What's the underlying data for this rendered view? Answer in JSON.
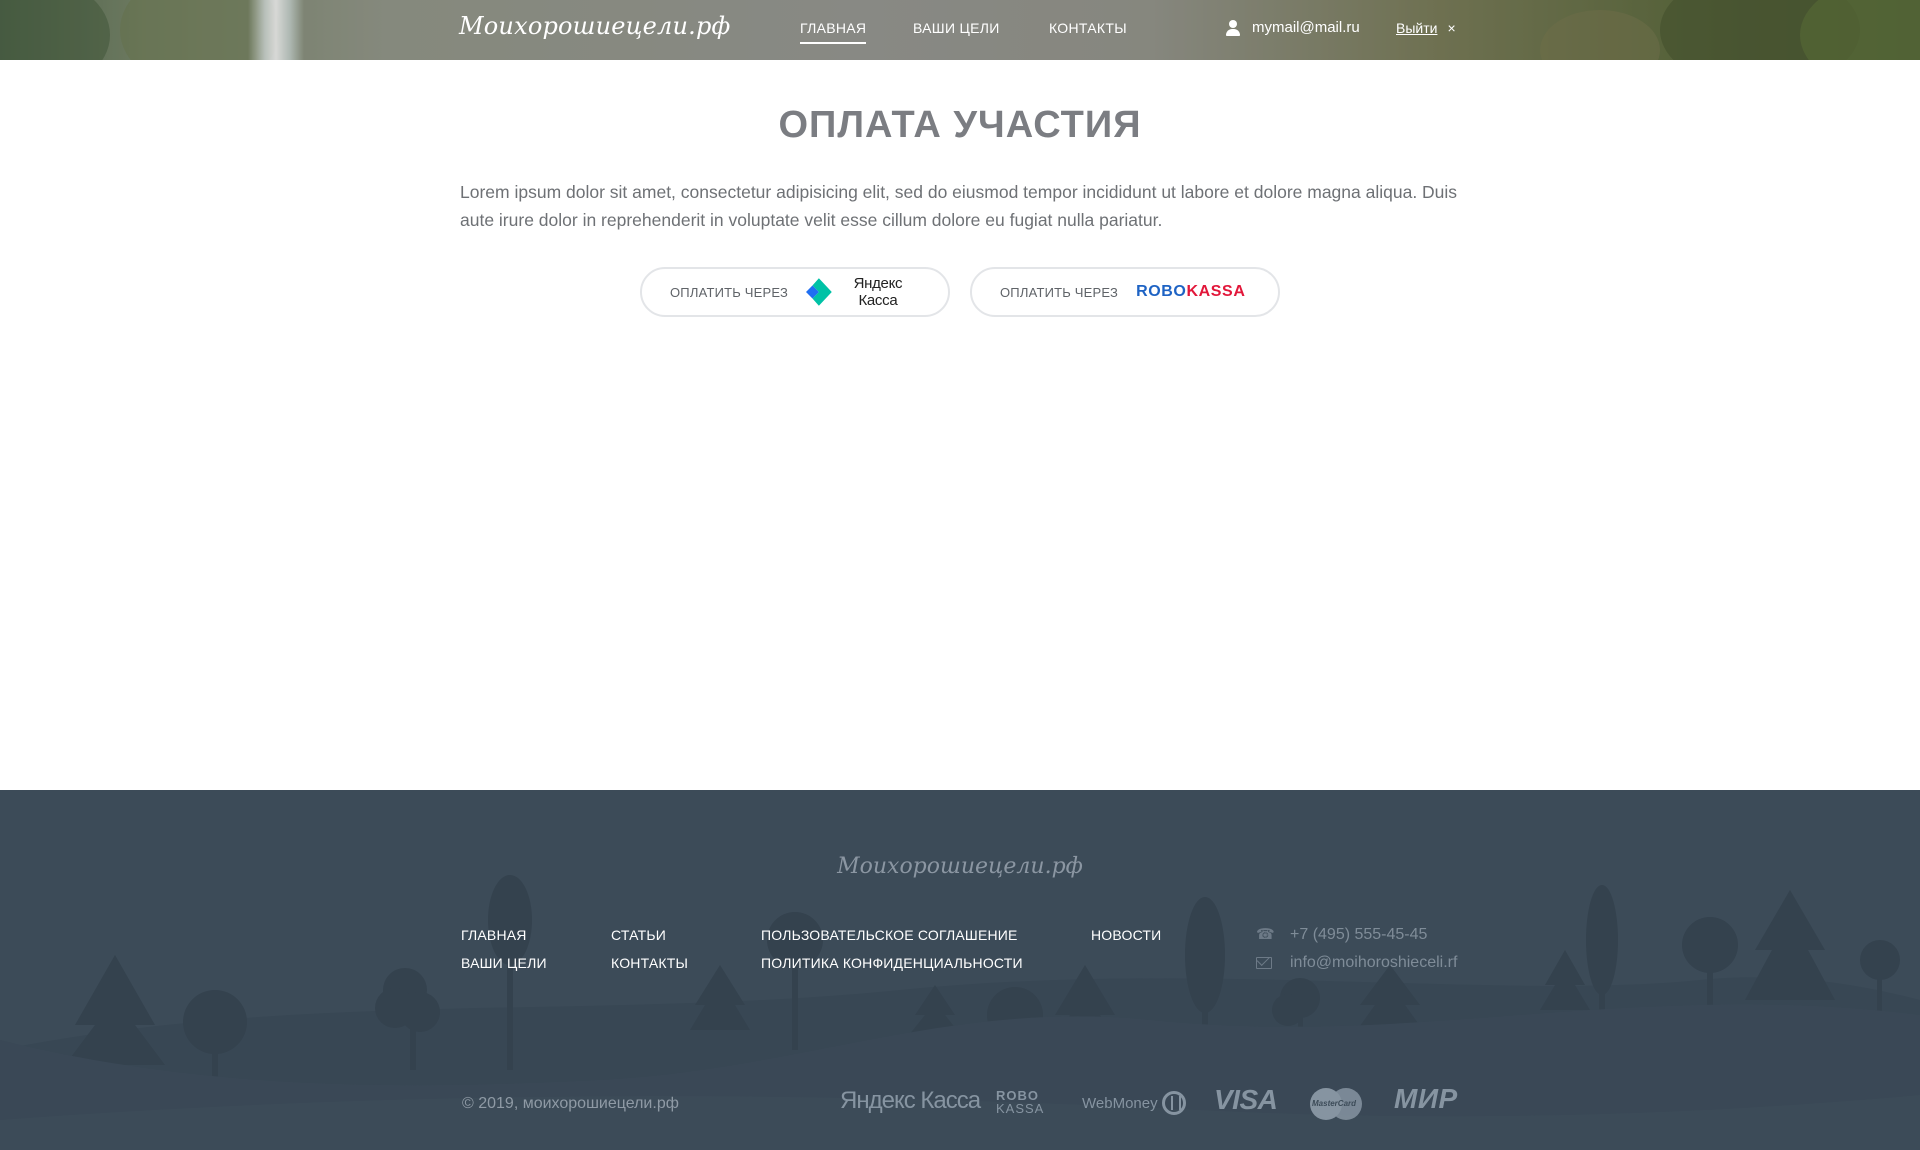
{
  "header": {
    "logo": "Моихорошиецели.рф",
    "nav": [
      {
        "label": "ГЛАВНАЯ",
        "active": true
      },
      {
        "label": "ВАШИ ЦЕЛИ",
        "active": false
      },
      {
        "label": "КОНТАКТЫ",
        "active": false
      }
    ],
    "user_email": "mymail@mail.ru",
    "logout_label": "Выйти",
    "close_glyph": "×",
    "icons": {
      "user": "user-icon",
      "close": "close-icon"
    }
  },
  "main": {
    "title": "ОПЛАТА УЧАСТИЯ",
    "intro": "Lorem ipsum dolor sit amet, consectetur adipisicing elit, sed do eiusmod tempor incididunt ut labore et dolore magna aliqua. Duis aute irure dolor in reprehenderit in voluptate velit esse cillum dolore eu fugiat nulla pariatur.",
    "payments": [
      {
        "label": "ОПЛАТИТЬ ЧЕРЕЗ",
        "provider": "Яндекс Касса"
      },
      {
        "label": "ОПЛАТИТЬ ЧЕРЕЗ",
        "provider_a": "ROBO",
        "provider_b": "KASSA"
      }
    ]
  },
  "footer": {
    "logo": "Моихорошиецели.рф",
    "nav": {
      "col1": [
        "ГЛАВНАЯ",
        "ВАШИ ЦЕЛИ"
      ],
      "col2": [
        "СТАТЬИ",
        "КОНТАКТЫ"
      ],
      "col3": [
        "ПОЛЬЗОВАТЕЛЬСКОЕ СОГЛАШЕНИЕ",
        "ПОЛИТИКА КОНФИДЕНЦИАЛЬНОСТИ"
      ],
      "col4": [
        "НОВОСТИ"
      ]
    },
    "phone": "+7 (495) 555-45-45",
    "email": "info@moihoroshieceli.rf",
    "copyright": "© 2019, моихорошиецели.рф",
    "payment_logos": {
      "yandex": "Яндекс Касса",
      "robokassa_top": "ROBO",
      "robokassa_bottom": "KASSA",
      "webmoney": "WebMoney",
      "visa": "VISA",
      "mastercard": "MasterCard",
      "mir": "МИР"
    }
  },
  "colors": {
    "title": "#7b7d82",
    "footer_bg": "#3c4b58",
    "robo_blue": "#1e63c4",
    "robo_red": "#e2173a"
  }
}
